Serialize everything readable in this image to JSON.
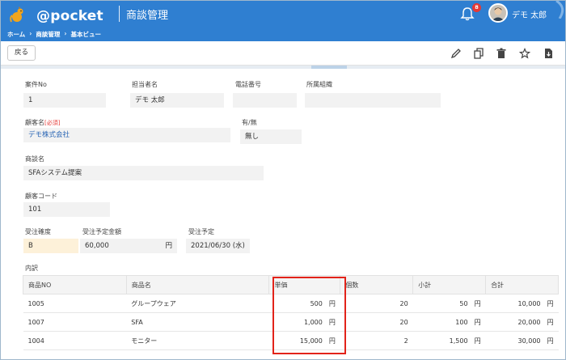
{
  "header": {
    "logo_text": "@pocket",
    "app_title": "商談管理",
    "notification_count": "8",
    "user_name": "デモ 太郎",
    "bg_color": "#2f7fd1",
    "breadcrumb": [
      "ホーム",
      "商談管理",
      "基本ビュー"
    ],
    "breadcrumb_sep": "›"
  },
  "toolbar": {
    "back_label": "戻る",
    "icons": [
      "edit-icon",
      "copy-icon",
      "trash-icon",
      "star-icon",
      "download-icon"
    ]
  },
  "form": {
    "case_no": {
      "label": "案件No",
      "value": "1"
    },
    "person": {
      "label": "担当者名",
      "value": "デモ 太郎"
    },
    "phone": {
      "label": "電話番号",
      "value": ""
    },
    "org": {
      "label": "所属組織",
      "value": ""
    },
    "customer": {
      "label": "顧客名",
      "required": "[必須]",
      "value": "デモ株式会社"
    },
    "exists": {
      "label": "有/無",
      "value": "無し"
    },
    "deal_name": {
      "label": "商談名",
      "value": "SFAシステム提案"
    },
    "customer_code": {
      "label": "顧客コード",
      "value": "101"
    },
    "certainty": {
      "label": "受注確度",
      "value": "B"
    },
    "amount": {
      "label": "受注予定金額",
      "value": "60,000",
      "unit": "円"
    },
    "order_date": {
      "label": "受注予定",
      "value": "2021/06/30 (水)"
    },
    "breakdown_label": "内訳"
  },
  "table": {
    "headers": [
      "商品NO",
      "商品名",
      "単価",
      "個数",
      "小計",
      "合計"
    ],
    "unit": "円",
    "rows": [
      {
        "no": "1005",
        "name": "グループウェア",
        "price": "500",
        "qty": "20",
        "subtotal": "50",
        "total": "10,000"
      },
      {
        "no": "1007",
        "name": "SFA",
        "price": "1,000",
        "qty": "20",
        "subtotal": "100",
        "total": "20,000"
      },
      {
        "no": "1004",
        "name": "モニター",
        "price": "15,000",
        "qty": "2",
        "subtotal": "1,500",
        "total": "30,000"
      }
    ]
  },
  "colors": {
    "highlight": "#e2231a",
    "link": "#2864b4",
    "required": "#e53935"
  }
}
